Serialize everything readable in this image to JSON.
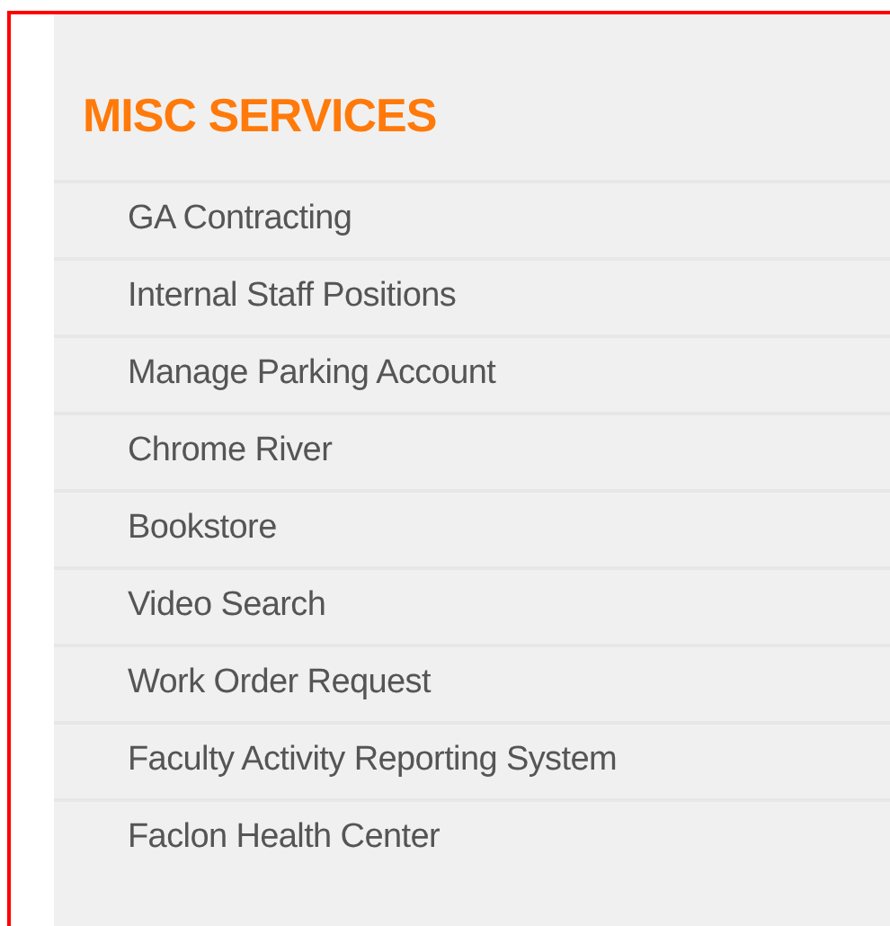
{
  "heading": "MISC SERVICES",
  "links": [
    {
      "label": "GA Contracting"
    },
    {
      "label": "Internal Staff Positions"
    },
    {
      "label": "Manage Parking Account"
    },
    {
      "label": "Chrome River"
    },
    {
      "label": "Bookstore"
    },
    {
      "label": "Video Search"
    },
    {
      "label": "Work Order Request"
    },
    {
      "label": "Faculty Activity Reporting System"
    },
    {
      "label": "Faclon Health Center"
    }
  ]
}
